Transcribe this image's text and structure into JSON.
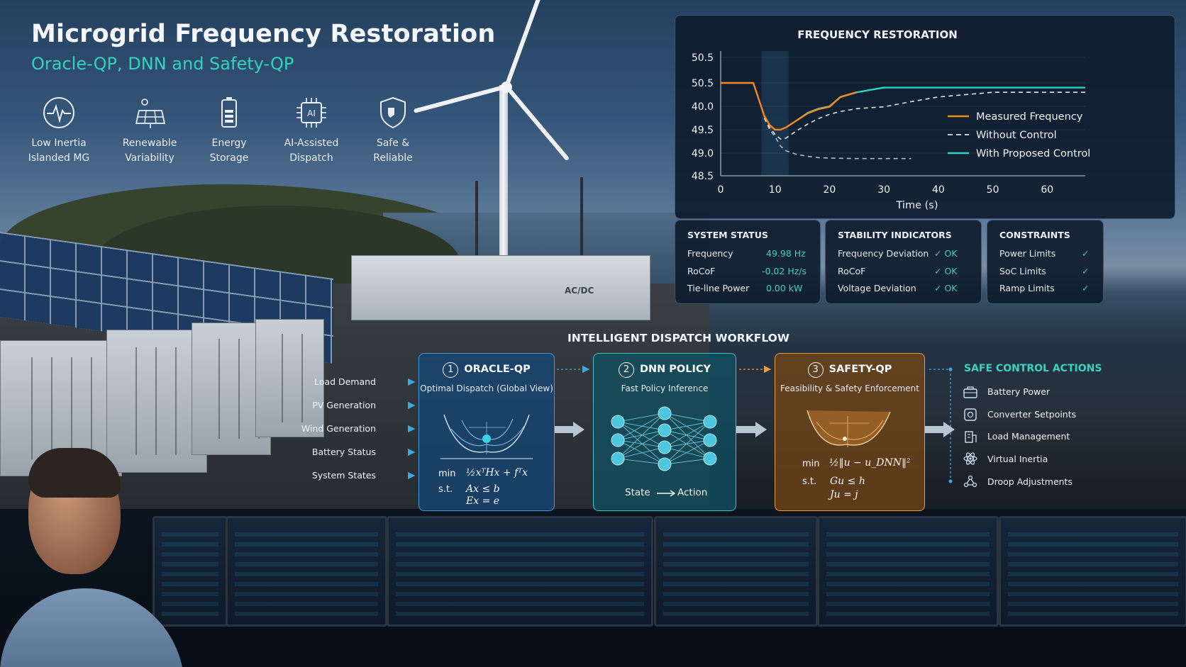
{
  "header": {
    "title": "Microgrid Frequency Restoration",
    "subtitle": "Oracle-QP, DNN and Safety-QP"
  },
  "features": [
    {
      "icon": "heartbeat-icon",
      "line1": "Low Inertia",
      "line2": "Islanded MG"
    },
    {
      "icon": "solar-panel-icon",
      "line1": "Renewable",
      "line2": "Variability"
    },
    {
      "icon": "battery-icon",
      "line1": "Energy",
      "line2": "Storage"
    },
    {
      "icon": "ai-chip-icon",
      "line1": "AI-Assisted",
      "line2": "Dispatch"
    },
    {
      "icon": "shield-icon",
      "line1": "Safe &",
      "line2": "Reliable"
    }
  ],
  "scene": {
    "building_label": "AC/DC"
  },
  "chart_data": {
    "type": "line",
    "title": "FREQUENCY RESTORATION",
    "xlabel": "Time (s)",
    "ylabel": "",
    "x_ticks": [
      "0",
      "10",
      "20",
      "30",
      "40",
      "50",
      "60"
    ],
    "y_ticks": [
      "50.5",
      "50.5",
      "40.0",
      "49.5",
      "49.0",
      "48.5"
    ],
    "legend_position": "right",
    "series": [
      {
        "name": "Measured Frequency",
        "color": "#f28b1e",
        "style": "solid",
        "x": [
          0,
          3,
          6,
          8,
          9,
          10,
          11,
          12,
          14,
          16,
          18,
          20,
          22,
          25
        ],
        "y": [
          50.05,
          50.05,
          50.05,
          49.8,
          49.6,
          49.5,
          49.5,
          49.55,
          49.7,
          49.85,
          49.94,
          49.99,
          50.02,
          50.03
        ]
      },
      {
        "name": "Without Control",
        "color": "#dfe6ee",
        "style": "dashed",
        "x": [
          8,
          9,
          10,
          11,
          12,
          13,
          14,
          16,
          18,
          20,
          22,
          25,
          30,
          35,
          40,
          50,
          60,
          67
        ],
        "y": [
          49.75,
          49.55,
          49.4,
          49.3,
          49.32,
          49.4,
          49.48,
          49.62,
          49.74,
          49.83,
          49.89,
          49.95,
          49.99,
          50.01,
          50.02,
          50.03,
          50.03,
          50.03
        ]
      },
      {
        "name": "With Proposed Control",
        "color": "#2fd3c0",
        "style": "solid",
        "x": [
          14,
          16,
          18,
          20,
          22,
          25,
          30,
          40,
          50,
          60,
          67
        ],
        "y": [
          49.7,
          49.86,
          49.95,
          50.0,
          50.02,
          50.03,
          50.04,
          50.04,
          50.04,
          50.04,
          50.04
        ]
      },
      {
        "name": "",
        "color": "#aeb9c4",
        "style": "dashed",
        "x": [
          8,
          9,
          10,
          11,
          12,
          14,
          16,
          18,
          20,
          25,
          30,
          35
        ],
        "y": [
          49.75,
          49.5,
          49.35,
          49.15,
          49.05,
          48.97,
          48.93,
          48.9,
          48.89,
          48.88,
          48.88,
          48.88
        ]
      }
    ],
    "shaded_region_x": [
      7.5,
      12.5
    ]
  },
  "system_status": {
    "title": "SYSTEM STATUS",
    "rows": [
      {
        "label": "Frequency",
        "value": "49.98 Hz"
      },
      {
        "label": "RoCoF",
        "value": "-0.02 Hz/s"
      },
      {
        "label": "Tie-line Power",
        "value": "0.00 kW"
      }
    ]
  },
  "stability": {
    "title": "STABILITY INDICATORS",
    "rows": [
      {
        "label": "Frequency Deviation",
        "value": "✓  OK"
      },
      {
        "label": "RoCoF",
        "value": "✓  OK"
      },
      {
        "label": "Voltage Deviation",
        "value": "✓  OK"
      }
    ]
  },
  "constraints": {
    "title": "CONSTRAINTS",
    "rows": [
      {
        "label": "Power Limits",
        "value": "✓"
      },
      {
        "label": "SoC Limits",
        "value": "✓"
      },
      {
        "label": "Ramp Limits",
        "value": "✓"
      }
    ]
  },
  "workflow": {
    "title": "INTELLIGENT DISPATCH WORKFLOW",
    "inputs": [
      "Load Demand",
      "PV Generation",
      "Wind Generation",
      "Battery Status",
      "System States"
    ],
    "oracle": {
      "num": "1",
      "title": "ORACLE-QP",
      "subtitle": "Optimal Dispatch (Global View)",
      "min_label": "min",
      "st_label": "s.t.",
      "objective": "½xᵀHx + fᵀx",
      "c1": "Ax ≤ b",
      "c2": "Ex = e"
    },
    "dnn": {
      "num": "2",
      "title": "DNN POLICY",
      "subtitle": "Fast Policy Inference",
      "state": "State",
      "action": "Action"
    },
    "safety": {
      "num": "3",
      "title": "SAFETY-QP",
      "subtitle": "Feasibility & Safety Enforcement",
      "min_label": "min",
      "st_label": "s.t.",
      "objective": "½‖u − u_DNN‖²",
      "c1": "Gu ≤ h",
      "c2": "Ju = j"
    },
    "safe_title": "SAFE CONTROL ACTIONS",
    "actions": [
      {
        "icon": "battery-toolbox-icon",
        "label": "Battery Power"
      },
      {
        "icon": "converter-gear-icon",
        "label": "Converter Setpoints"
      },
      {
        "icon": "building-load-icon",
        "label": "Load Management"
      },
      {
        "icon": "inertia-atom-icon",
        "label": "Virtual Inertia"
      },
      {
        "icon": "network-droop-icon",
        "label": "Droop Adjustments"
      }
    ]
  },
  "colors": {
    "accent_teal": "#37d3c1",
    "accent_orange": "#f29a36",
    "accent_blue": "#3e9ad8"
  }
}
